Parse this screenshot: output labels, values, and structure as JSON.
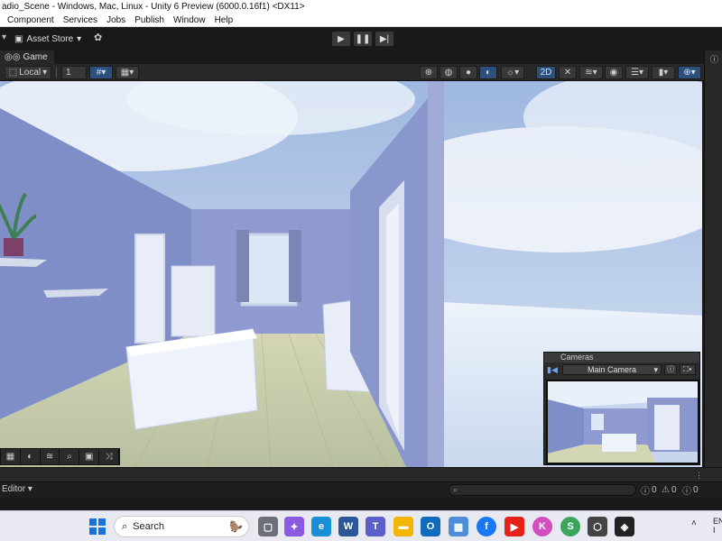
{
  "window": {
    "title": "adio_Scene - Windows, Mac, Linux - Unity 6 Preview (6000.0.16f1) <DX11>"
  },
  "menu": {
    "items": [
      "Component",
      "Services",
      "Jobs",
      "Publish",
      "Window",
      "Help"
    ]
  },
  "toolbar": {
    "asset_store_label": "Asset Store",
    "play_icon": "play-icon",
    "pause_icon": "pause-icon",
    "step_icon": "step-icon"
  },
  "game_tab": {
    "label": "Game"
  },
  "scene_toolbar": {
    "pivot_label": "Local",
    "grid_value": "1",
    "mode_2d_label": "2D"
  },
  "cameras_overlay": {
    "title": "Cameras",
    "selected_camera": "Main Camera"
  },
  "console": {
    "editor_label": "Editor",
    "log_count": "0",
    "warning_count": "0",
    "error_count": "0"
  },
  "taskbar": {
    "search_placeholder": "Search",
    "tray_lang": "EN",
    "tray_sub": "I"
  },
  "colors": {
    "accent_blue": "#2d4f7c",
    "unity_dark": "#191919",
    "panel": "#282828",
    "sky": "#b7c9e7",
    "wall": "#8a97cc",
    "floor": "#c9cfa8"
  }
}
